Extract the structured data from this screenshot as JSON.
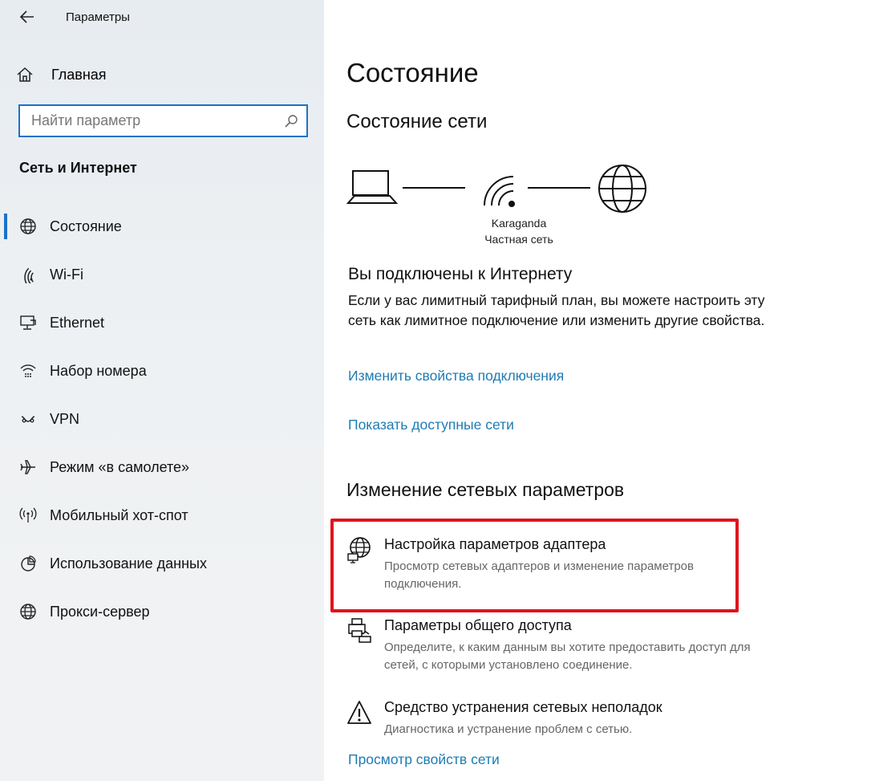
{
  "app": {
    "title": "Параметры"
  },
  "sidebar": {
    "home_label": "Главная",
    "search_placeholder": "Найти параметр",
    "section_title": "Сеть и Интернет",
    "items": [
      {
        "label": "Состояние",
        "icon": "globe-status-icon",
        "active": true
      },
      {
        "label": "Wi-Fi",
        "icon": "wifi-icon"
      },
      {
        "label": "Ethernet",
        "icon": "ethernet-icon"
      },
      {
        "label": "Набор номера",
        "icon": "dialup-icon"
      },
      {
        "label": "VPN",
        "icon": "vpn-icon"
      },
      {
        "label": "Режим «в самолете»",
        "icon": "airplane-icon"
      },
      {
        "label": "Мобильный хот-спот",
        "icon": "hotspot-icon"
      },
      {
        "label": "Использование данных",
        "icon": "data-usage-icon"
      },
      {
        "label": "Прокси-сервер",
        "icon": "proxy-globe-icon"
      }
    ]
  },
  "main": {
    "title": "Состояние",
    "network_status_heading": "Состояние сети",
    "network_name": "Karaganda",
    "network_type": "Частная сеть",
    "connected_title": "Вы подключены к Интернету",
    "connected_text": "Если у вас лимитный тарифный план, вы можете настроить эту сеть как лимитное подключение или изменить другие свойства.",
    "link_change_props": "Изменить свойства подключения",
    "link_show_networks": "Показать доступные сети",
    "change_heading": "Изменение сетевых параметров",
    "options": [
      {
        "title": "Настройка параметров адаптера",
        "desc": "Просмотр сетевых адаптеров и изменение параметров подключения.",
        "icon": "adapter-globe-icon"
      },
      {
        "title": "Параметры общего доступа",
        "desc": "Определите, к каким данным вы хотите предоставить доступ для сетей, с которыми установлено соединение.",
        "icon": "sharing-printer-icon"
      },
      {
        "title": "Средство устранения сетевых неполадок",
        "desc": "Диагностика и устранение проблем с сетью.",
        "icon": "warning-icon"
      }
    ],
    "link_view_props": "Просмотр свойств сети"
  },
  "colors": {
    "accent": "#1a73c8",
    "link": "#1d7cb4",
    "highlight": "#e0141e"
  }
}
